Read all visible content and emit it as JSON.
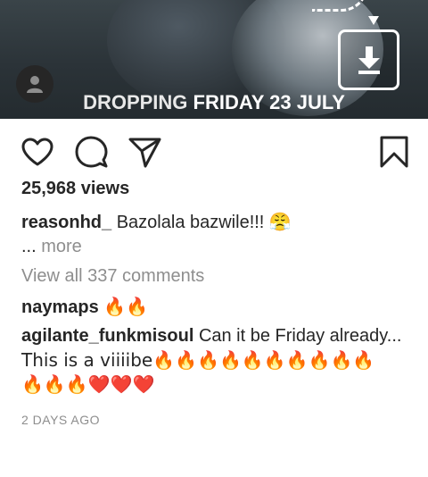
{
  "post": {
    "banner": {
      "word1": "DROPPING",
      "word2": "FRIDAY 23 JULY"
    }
  },
  "stats": {
    "views": "25,968 views"
  },
  "caption": {
    "username": "reasonhd_",
    "text": "Bazolala bazwile!!! 😤",
    "more_prefix": "...",
    "more_label": "more"
  },
  "view_all_comments": "View all 337 comments",
  "comments": [
    {
      "username": "naymaps",
      "text": "🔥🔥"
    },
    {
      "username": "agilante_funkmisoul",
      "text": "Can it be Friday already...",
      "text2": "This is a viiiibe🔥🔥🔥🔥🔥🔥🔥🔥🔥🔥",
      "text3": "🔥🔥🔥❤️❤️❤️"
    }
  ],
  "timestamp": "2 DAYS AGO",
  "colors": {
    "text": "#262626",
    "secondary": "#8e8e8e",
    "background": "#ffffff"
  }
}
